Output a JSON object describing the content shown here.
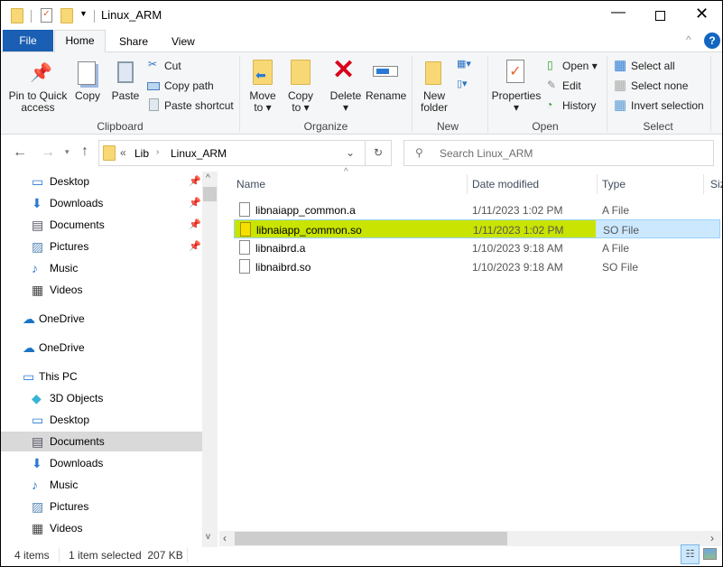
{
  "window": {
    "title": "Linux_ARM"
  },
  "tabs": [
    {
      "label": "File"
    },
    {
      "label": "Home"
    },
    {
      "label": "Share"
    },
    {
      "label": "View"
    }
  ],
  "ribbon": {
    "clipboard": {
      "label": "Clipboard",
      "pin": "Pin to Quick access",
      "pin_l1": "Pin to Quick",
      "pin_l2": "access",
      "copy": "Copy",
      "paste": "Paste",
      "cut": "Cut",
      "copy_path": "Copy path",
      "paste_shortcut": "Paste shortcut"
    },
    "organize": {
      "label": "Organize",
      "move_l1": "Move",
      "move_l2": "to",
      "copy_l1": "Copy",
      "copy_l2": "to",
      "delete": "Delete",
      "rename": "Rename"
    },
    "new": {
      "label": "New",
      "nf_l1": "New",
      "nf_l2": "folder"
    },
    "open": {
      "label": "Open",
      "properties": "Properties",
      "open": "Open",
      "edit": "Edit",
      "history": "History"
    },
    "select": {
      "label": "Select",
      "all": "Select all",
      "none": "Select none",
      "invert": "Invert selection"
    }
  },
  "address": {
    "overflow": "«",
    "crumbs": [
      "Lib",
      "Linux_ARM"
    ],
    "search_placeholder": "Search Linux_ARM"
  },
  "nav": {
    "items": [
      {
        "label": "Desktop",
        "pinned": true
      },
      {
        "label": "Downloads",
        "pinned": true
      },
      {
        "label": "Documents",
        "pinned": true
      },
      {
        "label": "Pictures",
        "pinned": true
      },
      {
        "label": "Music"
      },
      {
        "label": "Videos"
      },
      {
        "label": "OneDrive"
      },
      {
        "label": "OneDrive"
      },
      {
        "label": "This PC"
      },
      {
        "label": "3D Objects"
      },
      {
        "label": "Desktop"
      },
      {
        "label": "Documents",
        "selected": true
      },
      {
        "label": "Downloads"
      },
      {
        "label": "Music"
      },
      {
        "label": "Pictures"
      },
      {
        "label": "Videos"
      }
    ]
  },
  "columns": [
    "Name",
    "Date modified",
    "Type",
    "Size"
  ],
  "files": [
    {
      "name": "libnaiapp_common.a",
      "date": "1/11/2023 1:02 PM",
      "type": "A File"
    },
    {
      "name": "libnaiapp_common.so",
      "date": "1/11/2023 1:02 PM",
      "type": "SO File",
      "selected": true
    },
    {
      "name": "libnaibrd.a",
      "date": "1/10/2023 9:18 AM",
      "type": "A File"
    },
    {
      "name": "libnaibrd.so",
      "date": "1/10/2023 9:18 AM",
      "type": "SO File"
    }
  ],
  "status": {
    "count": "4 items",
    "selected": "1 item selected  207 KB"
  },
  "colors": {
    "file_tab": "#1a5fb4",
    "selection": "#cce8ff",
    "highlight": "#c8e400"
  }
}
